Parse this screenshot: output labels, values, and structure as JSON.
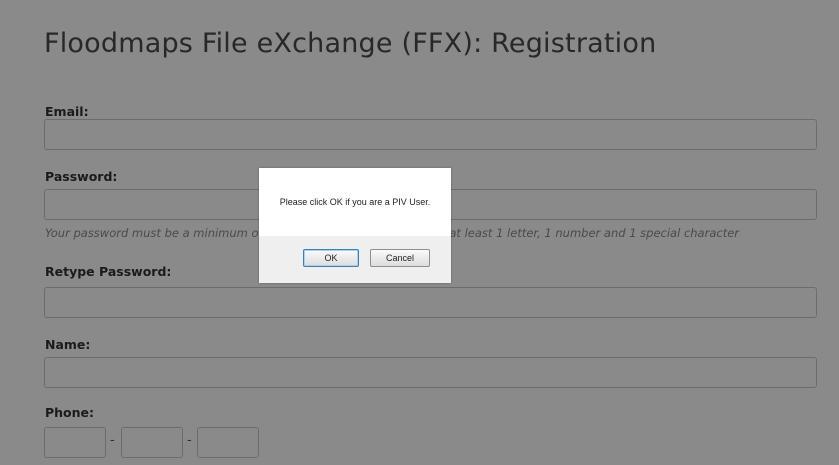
{
  "page": {
    "title": "Floodmaps File eXchange (FFX): Registration"
  },
  "form": {
    "email_label": "Email:",
    "password_label": "Password:",
    "password_help": "Your password must be a minimum of 12 characters long and contain at least 1 letter, 1 number and 1 special character",
    "retype_label": "Retype Password:",
    "name_label": "Name:",
    "phone_label": "Phone:",
    "phone_separator": "-"
  },
  "dialog": {
    "message": "Please click OK if you are a PIV User.",
    "ok_label": "OK",
    "cancel_label": "Cancel"
  },
  "colors": {
    "overlay": "rgba(0,0,0,0.46)",
    "ok_focus_border": "#3c7fb1"
  }
}
